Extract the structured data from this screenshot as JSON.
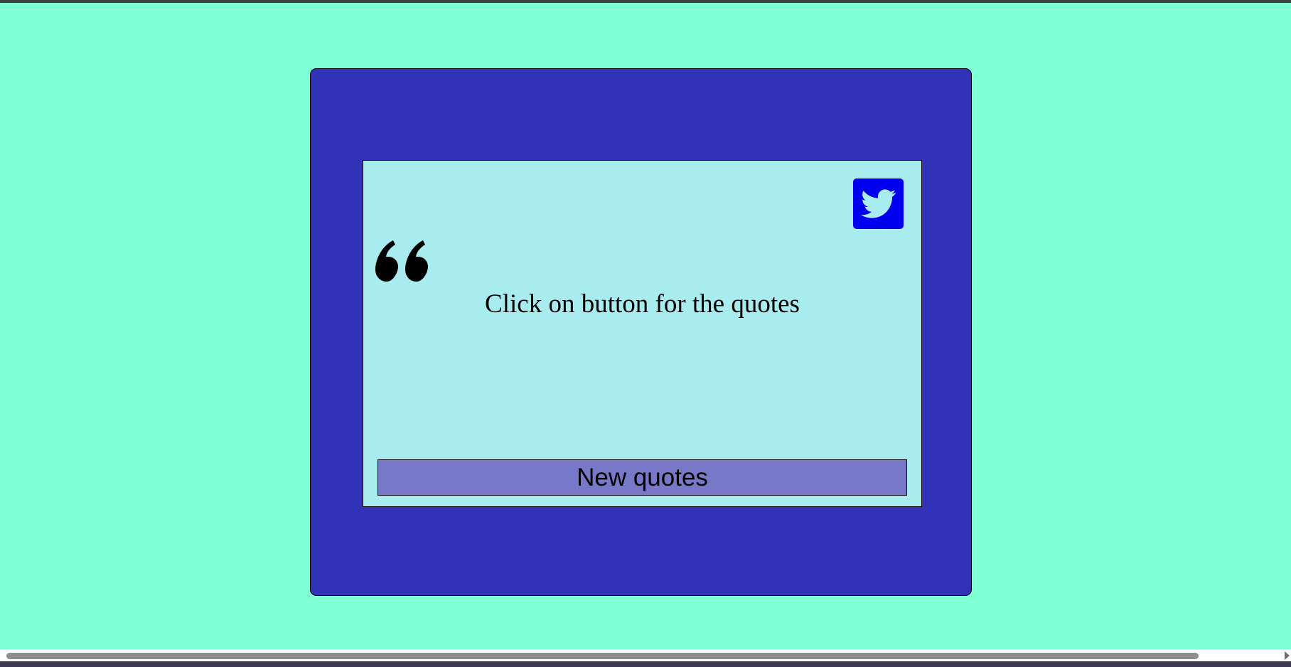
{
  "quote": {
    "text": "Click on button for the quotes",
    "quote_icon": "quote-left-icon"
  },
  "tweet": {
    "icon": "twitter-icon",
    "color": "#0000ee"
  },
  "button": {
    "label": "New quotes"
  },
  "colors": {
    "page_background": "#7fffd4",
    "outer_panel": "#3232b8",
    "inner_card": "#a8ecef",
    "button_background": "#7878c8"
  }
}
